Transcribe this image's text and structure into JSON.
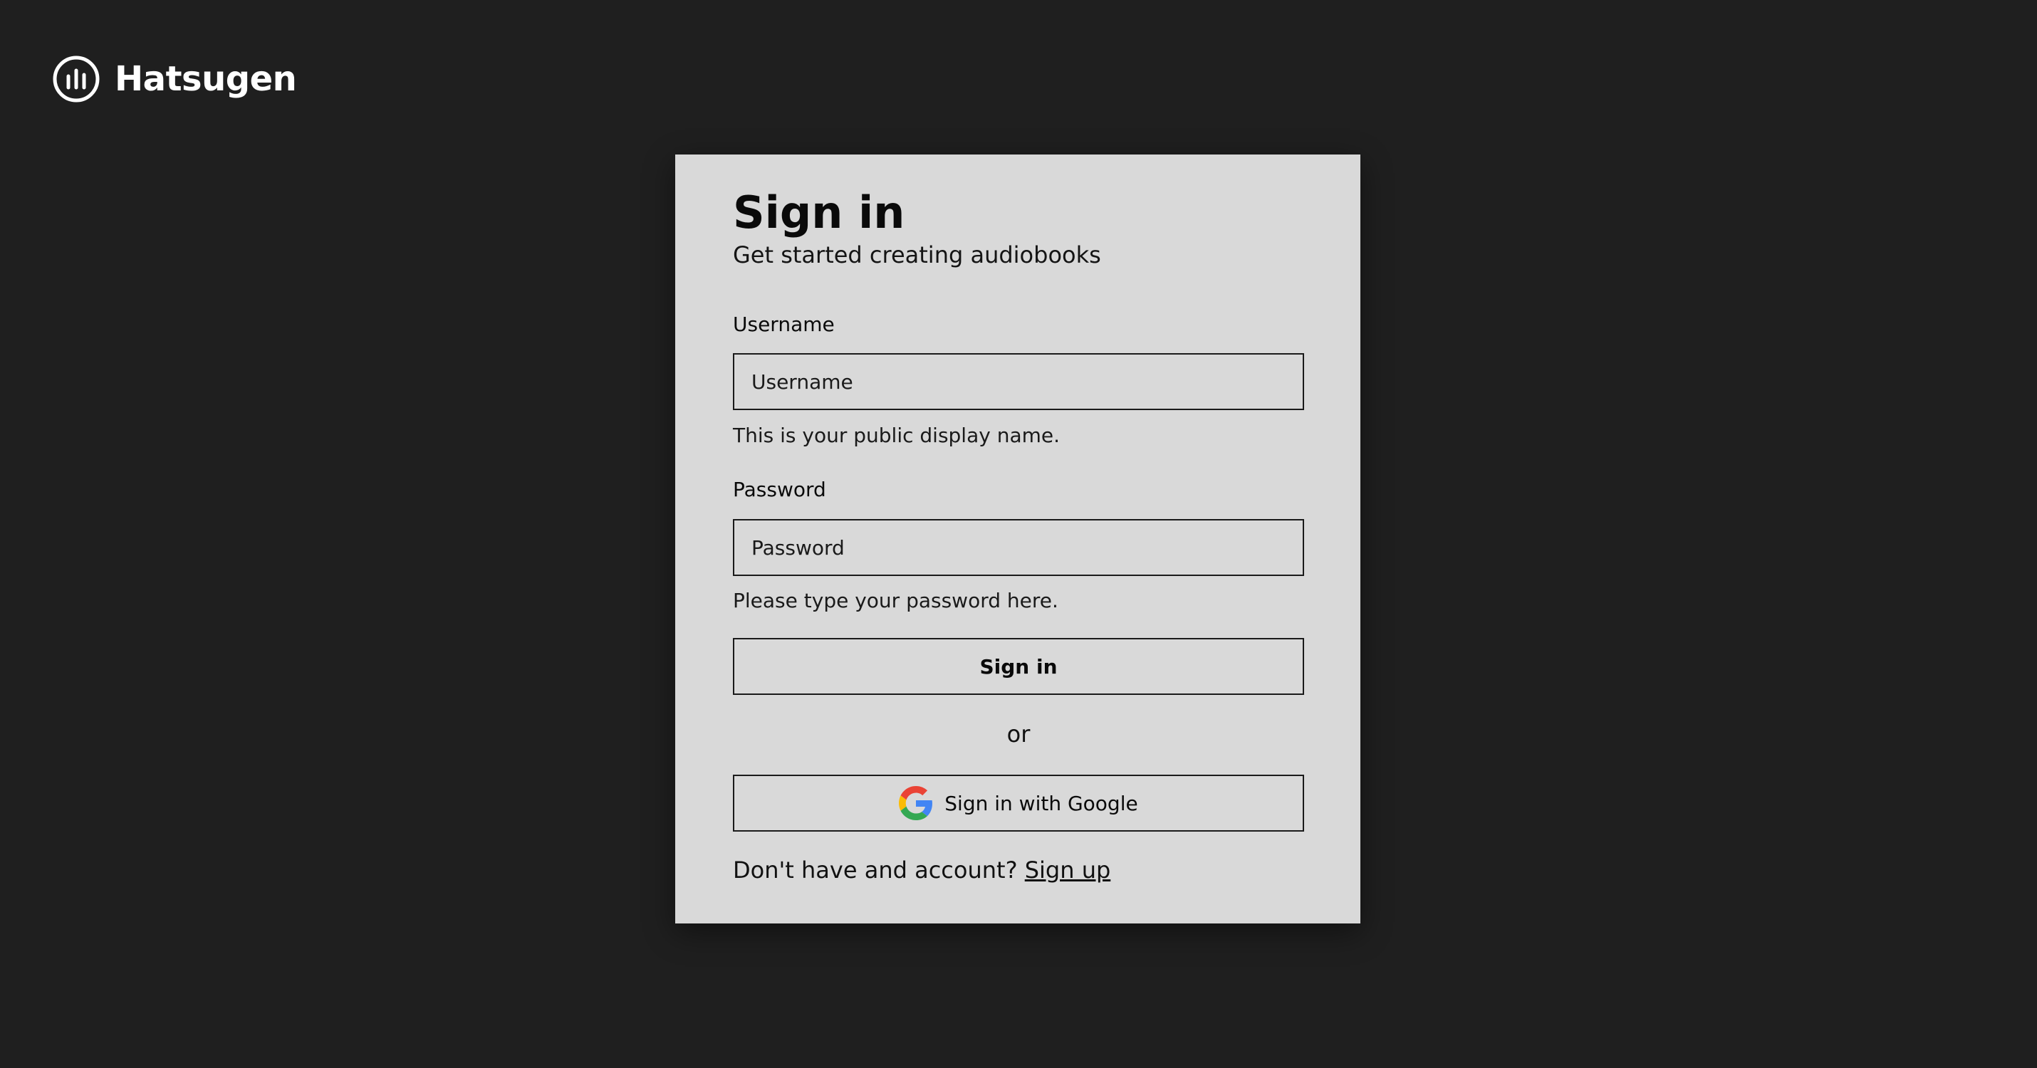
{
  "brand": {
    "icon": "bar-chart-circle-icon",
    "name": "Hatsugen"
  },
  "signin": {
    "title": "Sign in",
    "subtitle": "Get started creating audiobooks",
    "username": {
      "label": "Username",
      "value": "",
      "placeholder": "Username",
      "help": "This is your public display name."
    },
    "password": {
      "label": "Password",
      "value": "",
      "placeholder": "Password",
      "help": "Please type your password here."
    },
    "submit_label": "Sign in",
    "divider_text": "or",
    "google": {
      "icon": "google-icon",
      "label": "Sign in with Google"
    },
    "signup_prompt": "Don't have and account?",
    "signup_link": "Sign up"
  },
  "colors": {
    "background": "#1f1f1f",
    "card": "#d9d9d9",
    "text": "#0a0a0a",
    "brand_text": "#ffffff"
  }
}
